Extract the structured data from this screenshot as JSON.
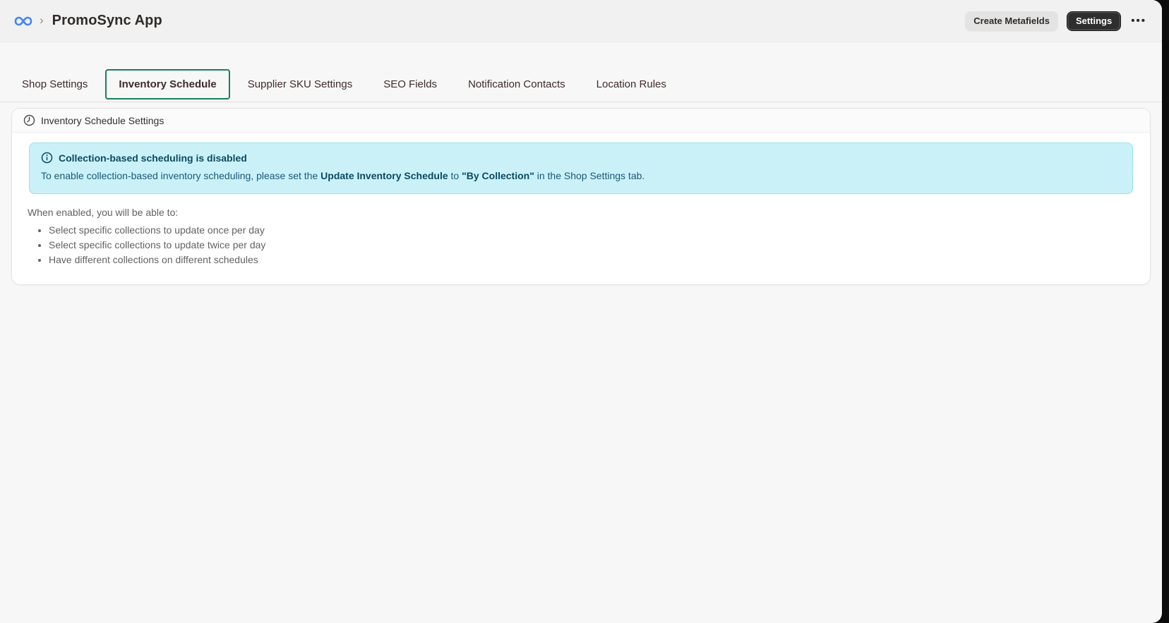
{
  "header": {
    "app_title": "PromoSync App",
    "breadcrumb_separator": "›",
    "create_metafields_label": "Create Metafields",
    "settings_label": "Settings",
    "more_icon_glyph": "•••"
  },
  "tabs": [
    {
      "label": "Shop Settings",
      "active": false
    },
    {
      "label": "Inventory Schedule",
      "active": true
    },
    {
      "label": "Supplier SKU Settings",
      "active": false
    },
    {
      "label": "SEO Fields",
      "active": false
    },
    {
      "label": "Notification Contacts",
      "active": false
    },
    {
      "label": "Location Rules",
      "active": false
    }
  ],
  "card": {
    "header_title": "Inventory Schedule Settings",
    "banner": {
      "title": "Collection-based scheduling is disabled",
      "desc_part1": "To enable collection-based inventory scheduling, please set the ",
      "desc_bold1": "Update Inventory Schedule",
      "desc_part2": " to ",
      "desc_bold2": "\"By Collection\"",
      "desc_part3": " in the Shop Settings tab."
    },
    "intro": "When enabled, you will be able to:",
    "bullets": [
      "Select specific collections to update once per day",
      "Select specific collections to update twice per day",
      "Have different collections on different schedules"
    ]
  },
  "colors": {
    "accent_blue": "#4285f4",
    "active_tab_green": "#1a7f5a",
    "banner_bg": "#cbf1f8",
    "banner_border": "#9be0ec",
    "banner_text": "#0b4a63",
    "primary_button_bg": "#2e2e2e",
    "secondary_button_bg": "#e3e3e3",
    "header_bg": "#f1f1f1",
    "page_bg": "#f7f7f7"
  }
}
